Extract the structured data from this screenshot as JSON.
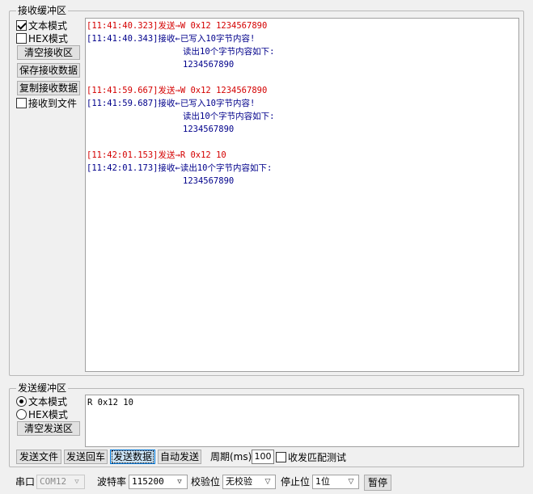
{
  "receive": {
    "title": "接收缓冲区",
    "text_mode_label": "文本模式",
    "text_mode_checked": true,
    "hex_mode_label": "HEX模式",
    "hex_mode_checked": false,
    "clear_button": "清空接收区",
    "save_button": "保存接收数据",
    "copy_button": "复制接收数据",
    "to_file_label": "接收到文件",
    "to_file_checked": false,
    "lines": [
      {
        "text": "[11:41:40.323]发送→W 0x12 1234567890",
        "color": "#d40000"
      },
      {
        "text": "[11:41:40.343]接收←已写入10字节内容!",
        "color": "#00008b"
      },
      {
        "text": "读出10个字节内容如下:",
        "color": "#00008b",
        "indent": true
      },
      {
        "text": "1234567890",
        "color": "#00008b",
        "indent": true
      },
      {
        "text": "[11:41:59.667]发送→W 0x12 1234567890",
        "color": "#d40000"
      },
      {
        "text": "[11:41:59.687]接收←已写入10字节内容!",
        "color": "#00008b"
      },
      {
        "text": "读出10个字节内容如下:",
        "color": "#00008b",
        "indent": true
      },
      {
        "text": "1234567890",
        "color": "#00008b",
        "indent": true
      },
      {
        "text": "[11:42:01.153]发送→R 0x12 10",
        "color": "#d40000"
      },
      {
        "text": "[11:42:01.173]接收←读出10个字节内容如下:",
        "color": "#00008b"
      },
      {
        "text": "1234567890",
        "color": "#00008b",
        "indent": true
      }
    ]
  },
  "send": {
    "title": "发送缓冲区",
    "text_mode_label": "文本模式",
    "text_mode_selected": true,
    "hex_mode_label": "HEX模式",
    "clear_button": "清空发送区",
    "content": "R 0x12 10"
  },
  "actions": {
    "send_file": "发送文件",
    "send_enter": "发送回车",
    "send_data": "发送数据",
    "auto_send": "自动发送",
    "period_label": "周期(ms)",
    "period_value": "100",
    "match_test_label": "收发匹配测试",
    "match_test_checked": false
  },
  "port": {
    "port_label": "串口",
    "port_value": "COM12",
    "baud_label": "波特率",
    "baud_value": "115200",
    "parity_label": "校验位",
    "parity_value": "无校验",
    "stop_label": "停止位",
    "stop_value": "1位",
    "pause_button": "暂停"
  }
}
